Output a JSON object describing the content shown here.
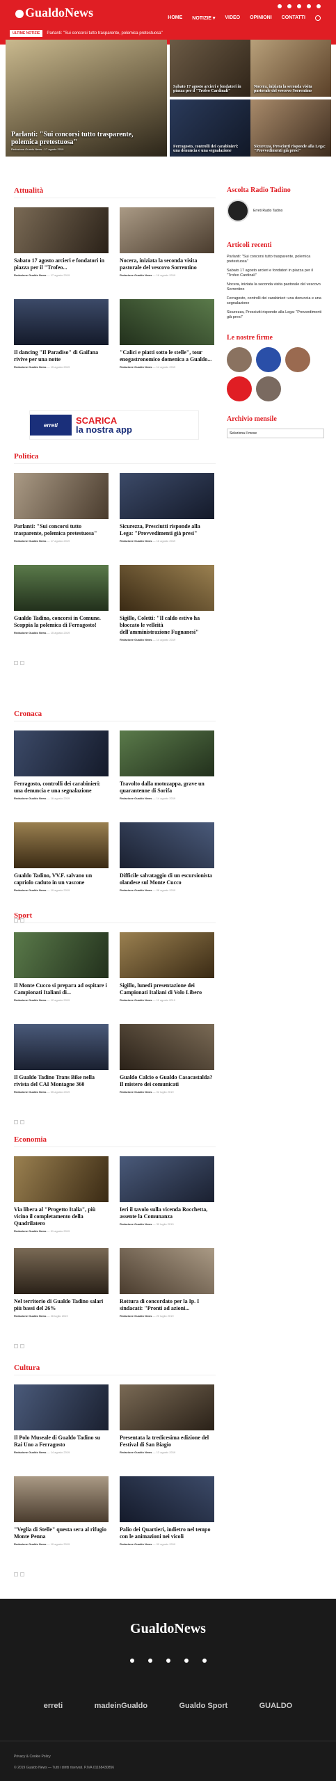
{
  "header": {
    "logo": "GualdoNews",
    "nav": [
      "HOME",
      "NOTIZIE ▾",
      "VIDEO",
      "OPINIONI",
      "CONTATTI"
    ],
    "ticker_tag": "ULTIME NOTIZIE",
    "ticker_text": "Parlanti: \"Sui concorsi tutto trasparente, polemica pretestuosa\""
  },
  "hero": {
    "main": {
      "title": "Parlanti: \"Sui concorsi tutto trasparente, polemica pretestuosa\"",
      "meta": "Redazione Gualdo News · 17 agosto 2019"
    },
    "items": [
      {
        "title": "Sabato 17 agosto arcieri e fondatori in piazza per il \"Trofeo Cardinali\""
      },
      {
        "title": "Nocera, iniziata la seconda visita pastorale del vescovo Sorrentino"
      },
      {
        "title": "Ferragosto, controlli dei carabinieri: una denuncia e una segnalazione"
      },
      {
        "title": "Sicurezza, Presciutti risponde alla Lega: \"Provvedimenti già presi\""
      }
    ]
  },
  "sections": [
    {
      "name": "Attualità",
      "cards": [
        {
          "t": "Sabato 17 agosto arcieri e fondatori in piazza per il \"Trofeo...",
          "a": "Redazione Gualdo News",
          "d": "17 agosto 2019"
        },
        {
          "t": "Nocera, iniziata la seconda visita pastorale del vescovo Sorrentino",
          "a": "Redazione Gualdo News",
          "d": "16 agosto 2019"
        },
        {
          "t": "Il dancing \"Il Paradiso\" di Gaifana rivive per una notte",
          "a": "Redazione Gualdo News",
          "d": "15 agosto 2019"
        },
        {
          "t": "\"Calici e piatti sotto le stelle\", tour enogastronomico domenica a Gualdo...",
          "a": "Redazione Gualdo News",
          "d": "14 agosto 2019"
        }
      ]
    },
    {
      "name": "Politica",
      "cards": [
        {
          "t": "Parlanti: \"Sui concorsi tutto trasparente, polemica pretestuosa\"",
          "a": "Redazione Gualdo News",
          "d": "17 agosto 2019"
        },
        {
          "t": "Sicurezza, Presciutti risponde alla Lega: \"Provvedimenti già presi\"",
          "a": "Redazione Gualdo News",
          "d": "16 agosto 2019"
        },
        {
          "t": "Gualdo Tadino, concorsi in Comune. Scoppia la polemica di Ferragosto!",
          "a": "Redazione Gualdo News",
          "d": "15 agosto 2019"
        },
        {
          "t": "Sigillo, Coletti: \"Il caldo estivo ha bloccato le velleità dell'amministrazione Fugnanesi\"",
          "a": "Redazione Gualdo News",
          "d": "14 agosto 2019"
        }
      ]
    },
    {
      "name": "Cronaca",
      "cards": [
        {
          "t": "Ferragosto, controlli dei carabinieri: una denuncia e una segnalazione",
          "a": "Redazione Gualdo News",
          "d": "16 agosto 2019"
        },
        {
          "t": "Travolto dalla motozappa, grave un quarantenne di Sorifa",
          "a": "Redazione Gualdo News",
          "d": "14 agosto 2019"
        },
        {
          "t": "Gualdo Tadino, VV.F. salvano un capriolo caduto in un vascone",
          "a": "Redazione Gualdo News",
          "d": "10 agosto 2019"
        },
        {
          "t": "Difficile salvataggio di un escursionista olandese sul Monte Cucco",
          "a": "Redazione Gualdo News",
          "d": "08 agosto 2019"
        }
      ]
    },
    {
      "name": "Sport",
      "cards": [
        {
          "t": "Il Monte Cucco si prepara ad ospitare i Campionati Italiani di...",
          "a": "Redazione Gualdo News",
          "d": "12 agosto 2019"
        },
        {
          "t": "Sigillo, lunedì presentazione dei Campionati Italiani di Volo Libero",
          "a": "Redazione Gualdo News",
          "d": "11 agosto 2019"
        },
        {
          "t": "Il Gualdo Tadino Trans Bike nella rivista del CAI Montagne 360",
          "a": "Redazione Gualdo News",
          "d": "05 agosto 2019"
        },
        {
          "t": "Gualdo Calcio o Gualdo Casacastalda? Il mistero dei comunicati",
          "a": "Redazione Gualdo News",
          "d": "02 luglio 2019"
        }
      ]
    },
    {
      "name": "Economia",
      "cards": [
        {
          "t": "Via libera al \"Progetto Italia\", più vicino il completamento della Quadrilatero",
          "a": "Redazione Gualdo News",
          "d": "01 agosto 2019"
        },
        {
          "t": "Ieri il tavolo sulla vicenda Rocchetta, assente la Comunanza",
          "a": "Redazione Gualdo News",
          "d": "30 luglio 2019"
        },
        {
          "t": "Nel territorio di Gualdo Tadino salari più bassi del 26%",
          "a": "Redazione Gualdo News",
          "d": "26 luglio 2019"
        },
        {
          "t": "Rottura di concordato per la Ip. I sindacati: \"Pronti ad azioni...",
          "a": "Redazione Gualdo News",
          "d": "20 luglio 2019"
        }
      ]
    },
    {
      "name": "Cultura",
      "cards": [
        {
          "t": "Il Polo Museale di Gualdo Tadino su Rai Uno a Ferragosto",
          "a": "Redazione Gualdo News",
          "d": "14 agosto 2019"
        },
        {
          "t": "Presentata la tredicesima edizione del Festival di San Biagio",
          "a": "Redazione Gualdo News",
          "d": "13 agosto 2019"
        },
        {
          "t": "\"Veglia di Stelle\" questa sera al rifugio Monte Penna",
          "a": "Redazione Gualdo News",
          "d": "10 agosto 2019"
        },
        {
          "t": "Palio dei Quartieri, indietro nel tempo con le animazioni nei vicoli",
          "a": "Redazione Gualdo News",
          "d": "09 agosto 2019"
        }
      ]
    }
  ],
  "banner": {
    "left": "erreti",
    "line1": "SCARICA",
    "line2": "la nostra app"
  },
  "sidebar": {
    "radio_title": "Ascolta Radio Tadino",
    "radio_name": "Erreti Radio Tadino",
    "recent_title": "Articoli recenti",
    "recent": [
      "Parlanti: \"Sui concorsi tutto trasparente, polemica pretestuosa\"",
      "Sabato 17 agosto arcieri e fondatori in piazza per il \"Trofeo Cardinali\"",
      "Nocera, iniziata la seconda visita pastorale del vescovo Sorrentino",
      "Ferragosto, controlli dei carabinieri: una denuncia e una segnalazione",
      "Sicurezza, Presciutti risponde alla Lega: \"Provvedimenti già presi\""
    ],
    "firms_title": "Le nostre firme",
    "archive_title": "Archivio mensile",
    "archive_select": "Seleziona il mese"
  },
  "footer": {
    "logo": "GualdoNews",
    "brands": [
      "erreti",
      "madeinGualdo",
      "Gualdo Sport",
      "GUALDO"
    ],
    "policy": "Privacy & Cookie Policy",
    "copy": "© 2019 Gualdo News — Tutti i diritti riservati. P.IVA 01168430856"
  }
}
